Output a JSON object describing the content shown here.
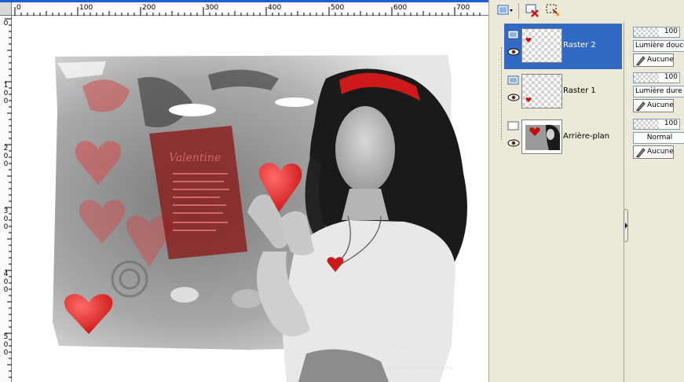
{
  "ruler": {
    "h_labels": [
      "0",
      "100",
      "200",
      "300",
      "400",
      "500",
      "600",
      "700"
    ],
    "v_labels": [
      "0",
      "100",
      "200",
      "300",
      "400",
      "500"
    ]
  },
  "canvas": {
    "watermark_text": "Pinuccia",
    "watermark_url": "www.maidire-grafica.eu"
  },
  "layers": [
    {
      "name": "Raster 2",
      "opacity": "100",
      "blend": "Lumière douce",
      "mask": "Aucune",
      "selected": true
    },
    {
      "name": "Raster 1",
      "opacity": "100",
      "blend": "Lumière dure",
      "mask": "Aucune",
      "selected": false
    },
    {
      "name": "Arrière-plan",
      "opacity": "100",
      "blend": "Normal",
      "mask": "Aucune",
      "selected": false
    }
  ],
  "colors": {
    "selection": "#316ac5",
    "accent_red": "#cc1a1a",
    "panel_bg": "#ece9d8"
  },
  "icons": [
    "new-layer-icon",
    "delete-layer-icon",
    "selection-icon",
    "eye-icon",
    "raster-layer-icon",
    "brush-icon"
  ]
}
